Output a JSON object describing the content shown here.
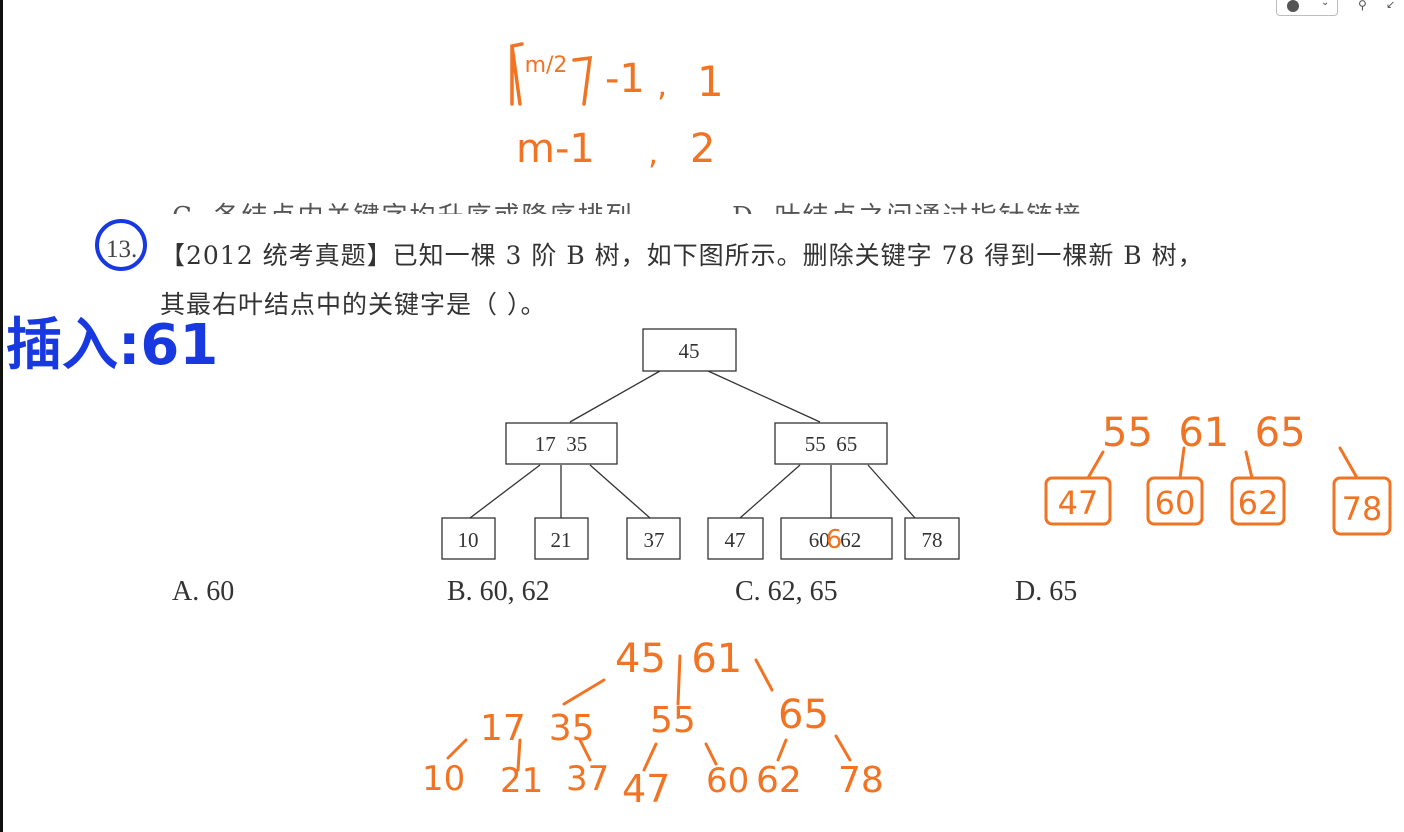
{
  "handwriting_top": {
    "line1_frac": "m/2",
    "line1_rest": "-1",
    "line1_sep": ",",
    "line1_val": "1",
    "line2_left": "m-1",
    "line2_sep": ",",
    "line2_val": "2"
  },
  "cut_text": {
    "left": "C.  各结点内关键字均升序或降序排列",
    "right": "D.  叶结点之间通过指针链接"
  },
  "question": {
    "number": "13.",
    "line1": "【2012 统考真题】已知一棵 3 阶 B 树，如下图所示。删除关键字 78 得到一棵新 B 树，",
    "line2": "其最右叶结点中的关键字是（   ）。"
  },
  "tree": {
    "root": "45",
    "left": "17  35",
    "right": "55  65",
    "leaves": [
      "10",
      "21",
      "37",
      "47",
      "60  62",
      "78"
    ],
    "overwrite_digit": "6"
  },
  "options": {
    "a": "A.   60",
    "b": "B.   60, 62",
    "c": "C.   62, 65",
    "d": "D.   65"
  },
  "handwriting_left": {
    "text": "插入:61"
  },
  "handwriting_right": {
    "top": "55  61  65",
    "leaves": [
      "47",
      "60",
      "62",
      "78"
    ]
  },
  "handwriting_bottom": {
    "root": "45  61",
    "left": "17  35",
    "mid": "55",
    "right": "65",
    "leaves": [
      "10",
      "21",
      "37",
      "47",
      "60",
      "62",
      "78"
    ]
  },
  "colors": {
    "orange": "#f07423",
    "blue": "#1839e0",
    "print": "#333333"
  }
}
